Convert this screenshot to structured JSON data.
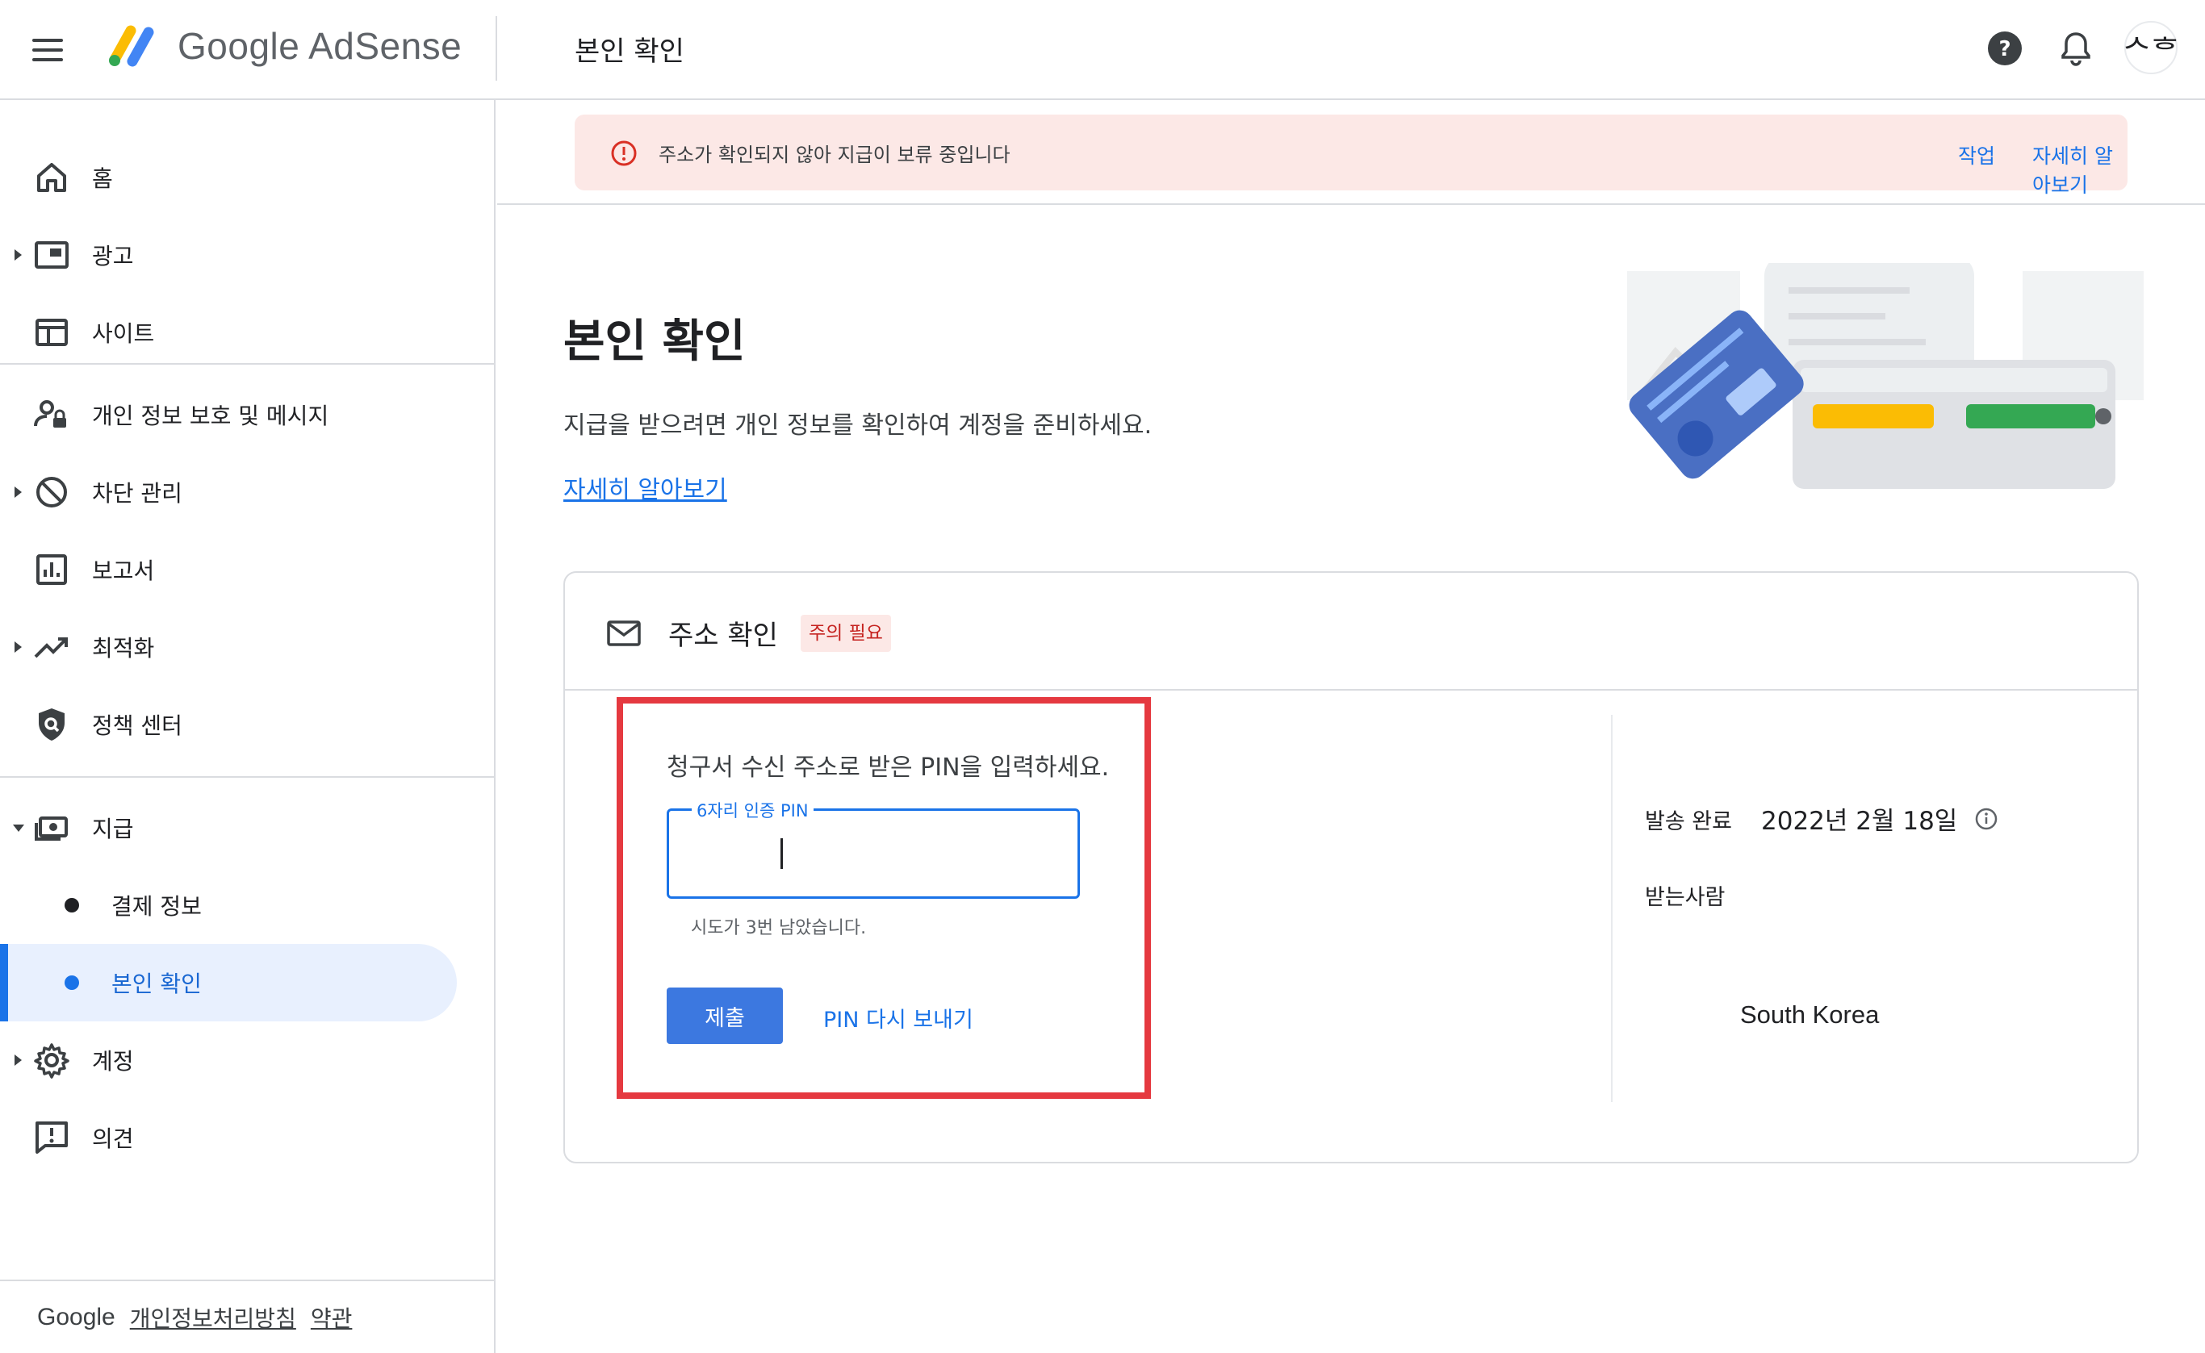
{
  "app": {
    "brand": "Google AdSense",
    "page_title": "본인 확인",
    "avatar_text": "ᄉᄒ"
  },
  "colors": {
    "accent": "#1a73e8",
    "warning_bg": "#fce8e6",
    "warning": "#c5221f",
    "highlight_border": "#e53940"
  },
  "sidebar": {
    "items": [
      {
        "label": "홈",
        "icon": "home-icon"
      },
      {
        "label": "광고",
        "icon": "ads-icon"
      },
      {
        "label": "사이트",
        "icon": "sites-icon"
      },
      {
        "label": "개인 정보 보호 및 메시지",
        "icon": "privacy-icon"
      },
      {
        "label": "차단 관리",
        "icon": "block-icon"
      },
      {
        "label": "보고서",
        "icon": "reports-icon"
      },
      {
        "label": "최적화",
        "icon": "optimization-icon"
      },
      {
        "label": "정책 센터",
        "icon": "policy-icon"
      },
      {
        "label": "지급",
        "icon": "payments-icon"
      },
      {
        "label": "결제 정보",
        "icon": "dot"
      },
      {
        "label": "본인 확인",
        "icon": "dot"
      },
      {
        "label": "계정",
        "icon": "settings-icon"
      },
      {
        "label": "의견",
        "icon": "feedback-icon"
      }
    ],
    "footer": {
      "google": "Google",
      "privacy": "개인정보처리방침",
      "terms": "약관"
    }
  },
  "banner": {
    "text": "주소가 확인되지 않아 지급이 보류 중입니다",
    "action": "작업",
    "learn_more": "자세히 알아보기"
  },
  "main": {
    "title": "본인 확인",
    "description": "지급을 받으려면 개인 정보를 확인하여 계정을 준비하세요.",
    "learn_more": "자세히 알아보기"
  },
  "address_card": {
    "title": "주소 확인",
    "badge": "주의 필요",
    "pin_prompt": "청구서 수신 주소로 받은 PIN을 입력하세요.",
    "pin_label": "6자리 인증 PIN",
    "pin_value": "",
    "attempts_text": "시도가 3번 남았습니다.",
    "submit_label": "제출",
    "resend_label": "PIN 다시 보내기",
    "shipped_label": "발송 완료",
    "shipped_date": "2022년 2월 18일",
    "recipient_label": "받는사람",
    "country": "South Korea"
  }
}
